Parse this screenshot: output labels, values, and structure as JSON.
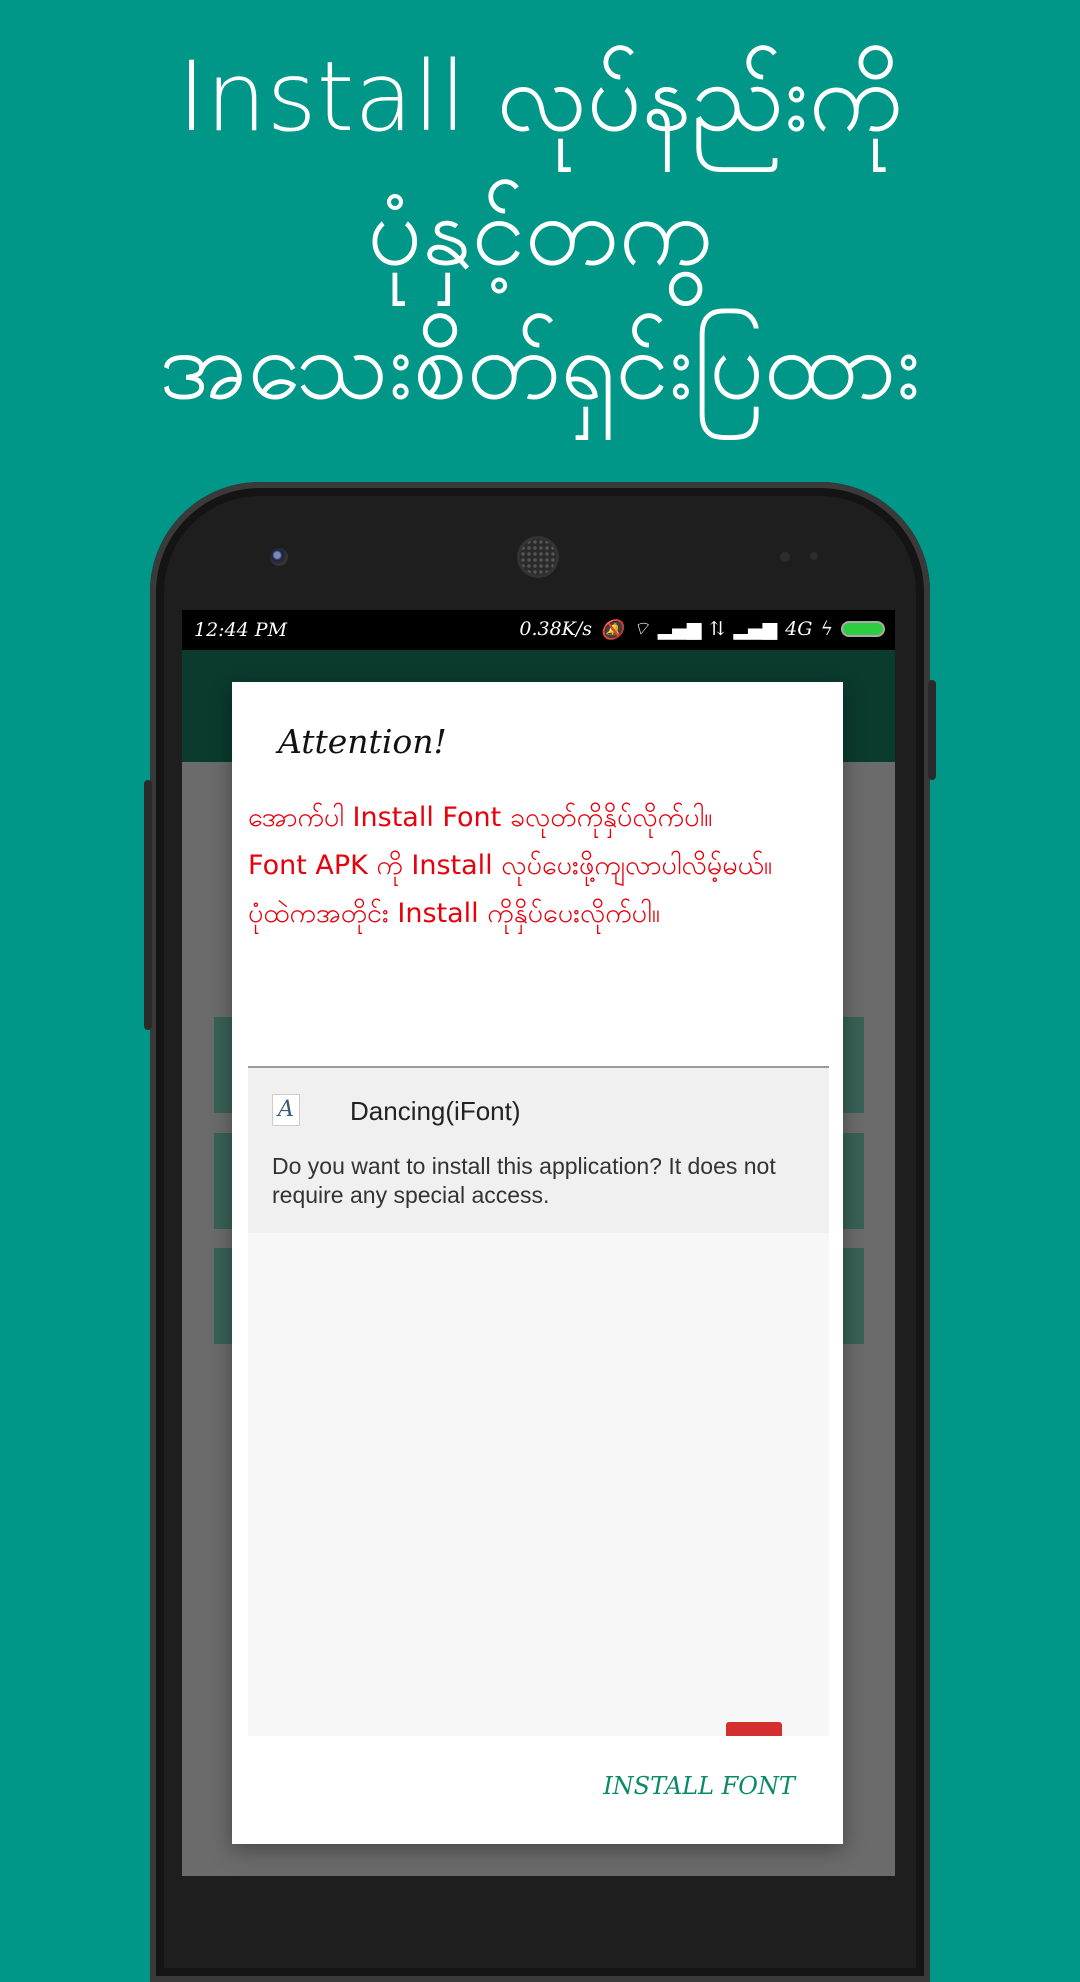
{
  "promo": {
    "lines": [
      "Install လုပ်နည်းကို",
      "ပုံနှင့်တကွ",
      "အသေးစိတ်ရှင်းပြထား"
    ]
  },
  "status_bar": {
    "time": "12:44 PM",
    "speed": "0.38K/s",
    "network": "4G",
    "battery_color": "#2ecc40"
  },
  "dialog": {
    "title": "Attention!",
    "message_lines": [
      "အောက်ပါ Install Font ခလုတ်ကိုနှိပ်လိုက်ပါ။",
      "Font APK ကို Install လုပ်ပေးဖို့ကျလာပါလိမ့်မယ်။",
      "ပုံထဲကအတိုင်း Install ကိုနှိပ်ပေးလိုက်ပါ။"
    ],
    "message_color": "#e8000c",
    "install_screenshot": {
      "icon_glyph": "A",
      "app_name": "Dancing(iFont)",
      "description": "Do you want to install this application? It does not require any special access."
    },
    "action_label": "INSTALL FONT",
    "action_color": "#0a8a6a"
  },
  "colors": {
    "background": "#009688",
    "app_bar": "#0a3b2e"
  }
}
